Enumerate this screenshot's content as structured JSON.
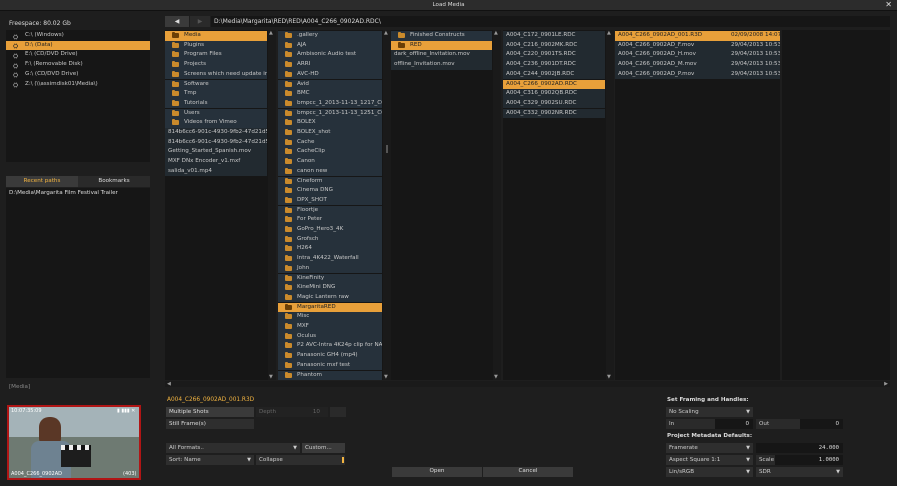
{
  "window": {
    "title": "Load Media",
    "close": "✕"
  },
  "freespace": "Freespace: 80.02 Gb",
  "drives": [
    {
      "label": "C:\\ (Windows)",
      "selected": false
    },
    {
      "label": "D:\\ (Data)",
      "selected": true
    },
    {
      "label": "E:\\ (CD/DVD Drive)",
      "selected": false
    },
    {
      "label": "F:\\ (Removable Disk)",
      "selected": false
    },
    {
      "label": "G:\\ (CD/DVD Drive)",
      "selected": false
    },
    {
      "label": "Z:\\ (\\\\assimdisk01\\Media\\)",
      "selected": false
    }
  ],
  "recent": {
    "tabs": [
      "Recent paths",
      "Bookmarks"
    ],
    "items": [
      "D:\\Media\\Margarita Film Festival Trailer"
    ]
  },
  "nav": {
    "back": "◀",
    "forward": "▶",
    "path": "D:\\Media\\Margarita\\RED\\RED\\A004_C266_0902AD.RDC\\"
  },
  "col1": [
    {
      "label": "Media",
      "type": "folder",
      "selected": true
    },
    {
      "label": "Plugins",
      "type": "folder"
    },
    {
      "label": "Program Files",
      "type": "folder"
    },
    {
      "label": "Projects",
      "type": "folder"
    },
    {
      "label": "Screens which need update in ..",
      "type": "folder"
    },
    {
      "label": "Software",
      "type": "folder"
    },
    {
      "label": "Tmp",
      "type": "folder"
    },
    {
      "label": "Tutorials",
      "type": "folder"
    },
    {
      "label": "Users",
      "type": "folder"
    },
    {
      "label": "Videos from Vimeo",
      "type": "folder"
    },
    {
      "label": "814b6cc6-901c-4930-9fb2-47d21d521..",
      "type": "file"
    },
    {
      "label": "814b6cc6-901c-4930-9fb2-47d21d521..",
      "type": "file"
    },
    {
      "label": "Getting_Started_Spanish.mov",
      "type": "file"
    },
    {
      "label": "MXF DNx Encoder_v1.mxf",
      "type": "file"
    },
    {
      "label": "salida_v01.mp4",
      "type": "file"
    }
  ],
  "col2": [
    {
      "label": ".gallery"
    },
    {
      "label": "AJA"
    },
    {
      "label": "Ambisonic Audio test"
    },
    {
      "label": "ARRI"
    },
    {
      "label": "AVC-HD"
    },
    {
      "label": "Avid"
    },
    {
      "label": "BMC"
    },
    {
      "label": "bmpcc_1_2013-11-13_1217_C0.."
    },
    {
      "label": "bmpcc_1_2013-11-13_1251_C0.."
    },
    {
      "label": "BOLEX"
    },
    {
      "label": "BOLEX_shot"
    },
    {
      "label": "Cache"
    },
    {
      "label": "CacheClip"
    },
    {
      "label": "Canon"
    },
    {
      "label": "canon new"
    },
    {
      "label": "Cineform"
    },
    {
      "label": "Cinema DNG"
    },
    {
      "label": "DPX_SHOT"
    },
    {
      "label": "Floortje"
    },
    {
      "label": "For Peter"
    },
    {
      "label": "GoPro_Hero3_4K"
    },
    {
      "label": "Grofsch"
    },
    {
      "label": "H264"
    },
    {
      "label": "Intra_4K422_Waterfall"
    },
    {
      "label": "John"
    },
    {
      "label": "KineFinity"
    },
    {
      "label": "KineMini DNG"
    },
    {
      "label": "Magic Lantern raw"
    },
    {
      "label": "MargaritaRED",
      "selected": true
    },
    {
      "label": "Misc"
    },
    {
      "label": "MXF"
    },
    {
      "label": "Oculus"
    },
    {
      "label": "P2 AVC-Intra 4K24p clip for NAB.."
    },
    {
      "label": "Panasonic GH4 (mp4)"
    },
    {
      "label": "Panasonic mxf test"
    },
    {
      "label": "Phantom"
    }
  ],
  "col3": [
    {
      "label": "Finished Constructs",
      "type": "folder"
    },
    {
      "label": "RED",
      "type": "folder",
      "selected": true
    },
    {
      "label": "dark_offline_Invitation.mov",
      "type": "file"
    },
    {
      "label": "offline_Invitation.mov",
      "type": "file"
    }
  ],
  "col4": [
    {
      "label": "A004_C172_0901LE.RDC"
    },
    {
      "label": "A004_C216_0902MK.RDC"
    },
    {
      "label": "A004_C220_0901TS.RDC"
    },
    {
      "label": "A004_C236_0901DT.RDC"
    },
    {
      "label": "A004_C244_0902JB.RDC"
    },
    {
      "label": "A004_C266_0902AD.RDC",
      "selected": true
    },
    {
      "label": "A004_C316_0902QB.RDC"
    },
    {
      "label": "A004_C329_0902SU.RDC"
    },
    {
      "label": "A004_C332_0902NR.RDC"
    }
  ],
  "col5": [
    {
      "name": "A004_C266_0902AD_001.R3D",
      "date": "02/09/2008 14:07",
      "selected": true
    },
    {
      "name": "A004_C266_0902AD_F.mov",
      "date": "29/04/2013 10:53"
    },
    {
      "name": "A004_C266_0902AD_H.mov",
      "date": "29/04/2013 10:53"
    },
    {
      "name": "A004_C266_0902AD_M.mov",
      "date": "29/04/2013 10:53"
    },
    {
      "name": "A004_C266_0902AD_P.mov",
      "date": "29/04/2013 10:53"
    }
  ],
  "media_label": "[Media]",
  "preview": {
    "timecode": "10:07:35:09",
    "clip": "A004_C266_0902AD",
    "count": "(403)"
  },
  "selected_file": "A004_C266_0902AD_001.R3D",
  "shots": {
    "multiple": "Multiple Shots",
    "still": "Still Frame(s)",
    "depth_label": "Depth",
    "depth_value": "10"
  },
  "filter": {
    "formats": "All Formats..",
    "custom": "Custom...",
    "sort": "Sort: Name",
    "collapse": "Collapse"
  },
  "buttons": {
    "open": "Open",
    "cancel": "Cancel"
  },
  "framing": {
    "title": "Set Framing and Handles:",
    "scaling": "No Scaling",
    "in_label": "In",
    "in_value": "0",
    "out_label": "Out",
    "out_value": "0"
  },
  "metadata": {
    "title": "Project Metadata Defaults:",
    "framerate_label": "Framerate",
    "framerate_value": "24.000",
    "aspect": "Aspect Square 1:1",
    "scale_label": "Scale",
    "scale_value": "1.0000",
    "colorspace": "Lin/sRGB",
    "range": "SDR"
  },
  "colors": {
    "selection": "#e8a03a",
    "folder": "#c98a2c",
    "accent_text": "#f2b441"
  }
}
